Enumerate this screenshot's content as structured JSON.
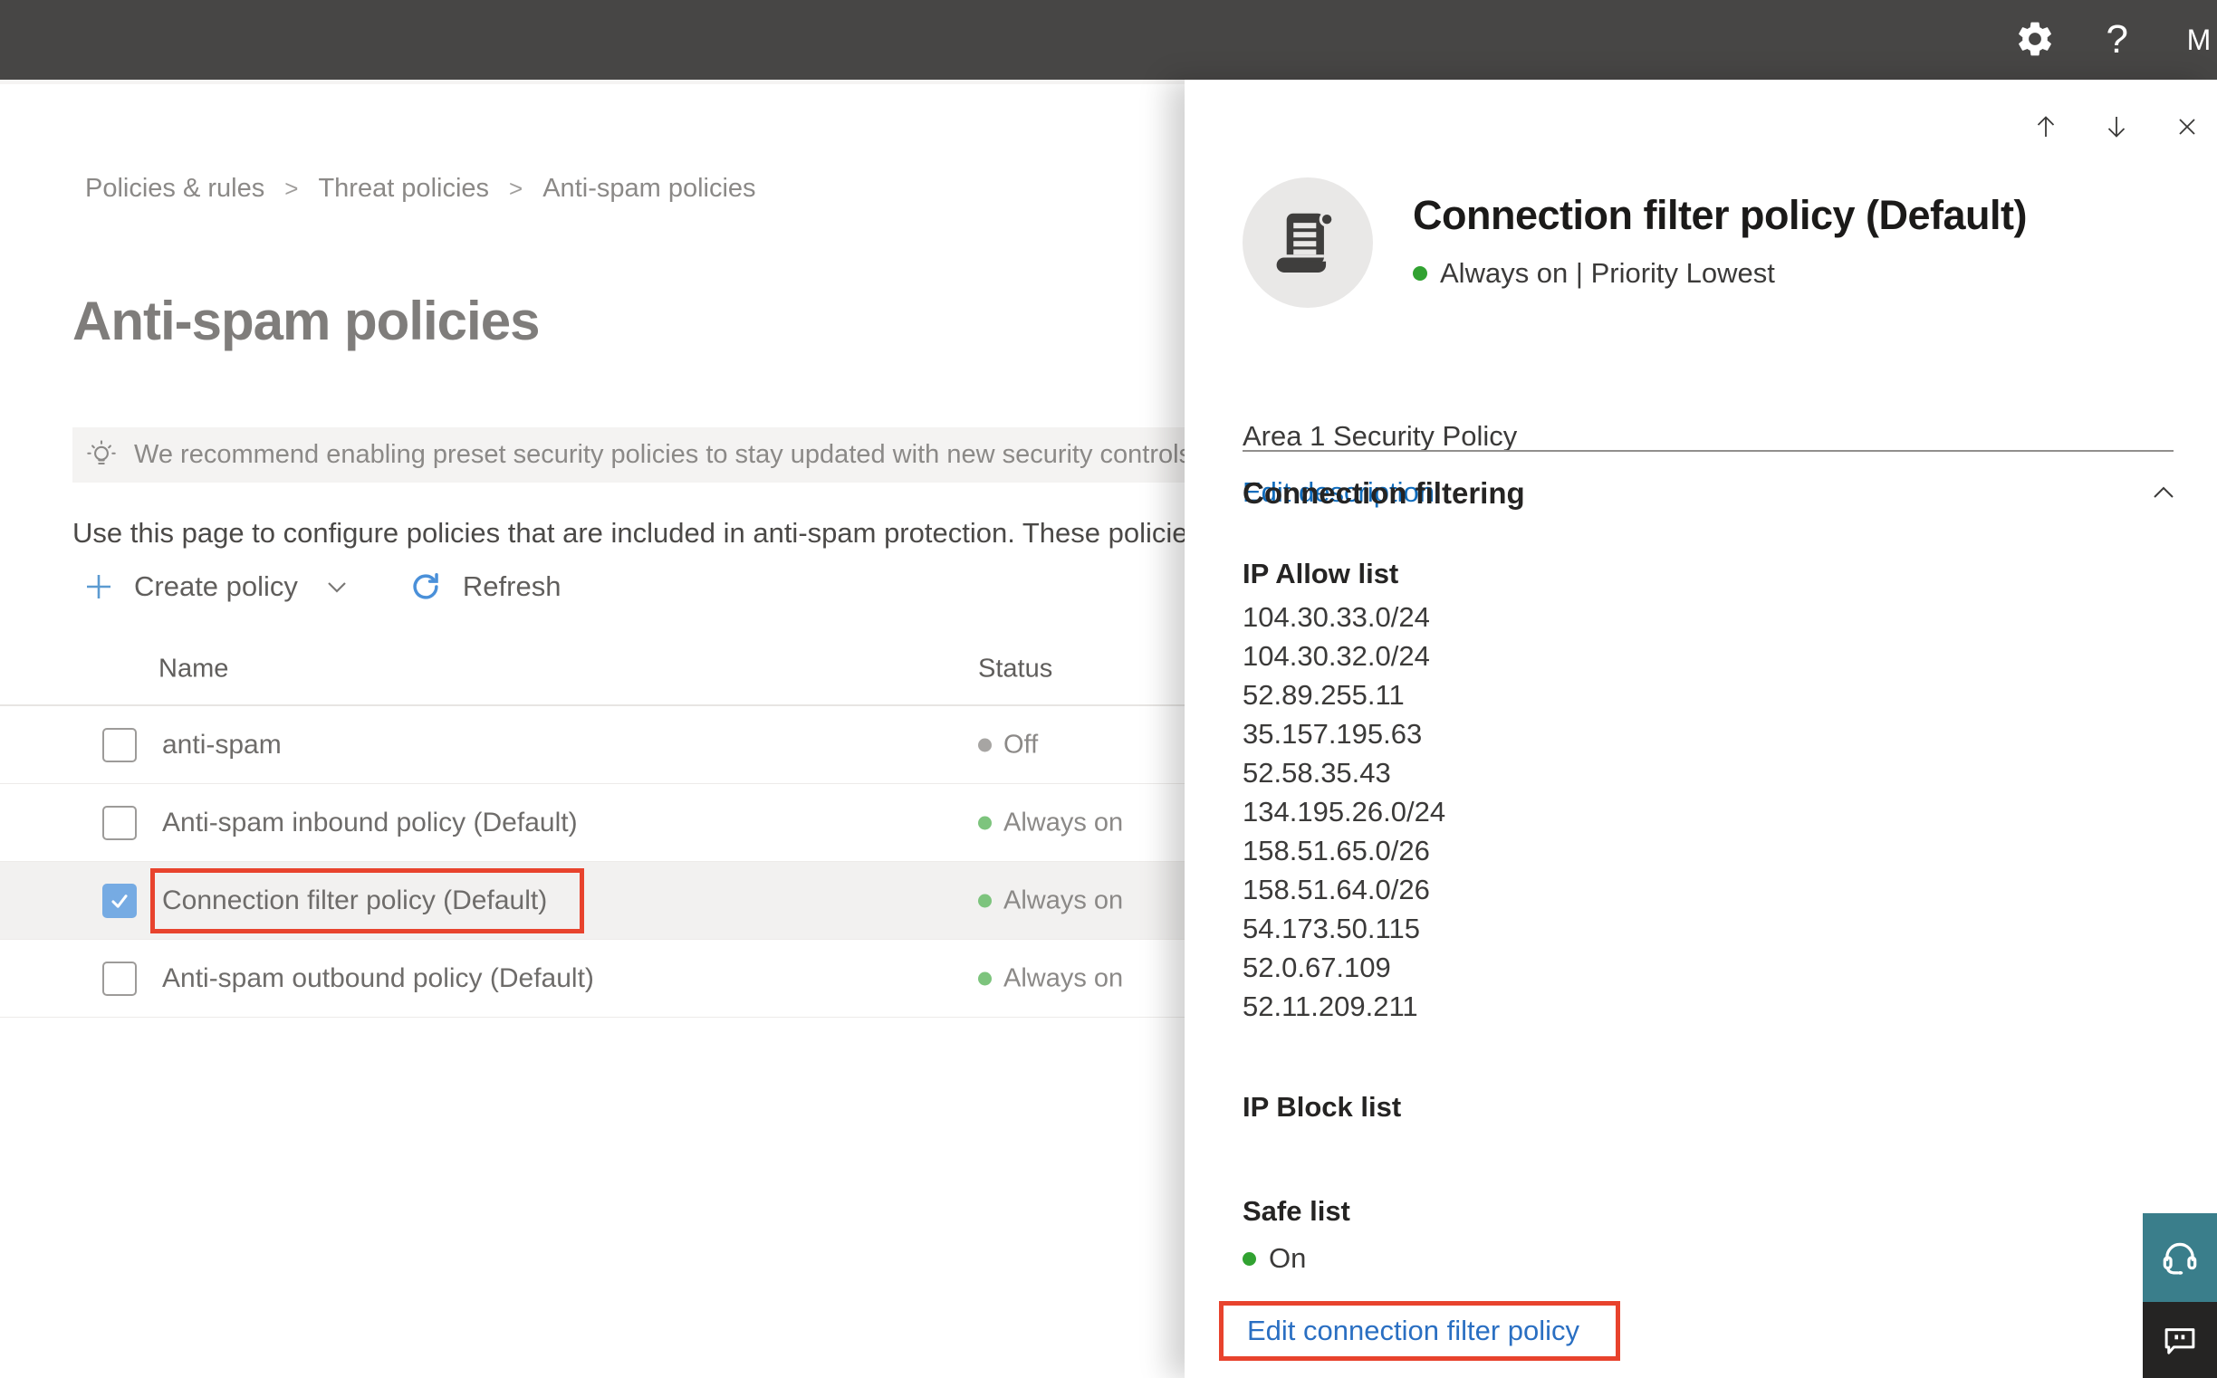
{
  "topbar": {
    "avatar_initial": "M",
    "help_glyph": "?"
  },
  "breadcrumb": {
    "items": [
      "Policies & rules",
      "Threat policies",
      "Anti-spam policies"
    ],
    "separator": ">"
  },
  "page": {
    "title": "Anti-spam policies",
    "banner": {
      "icon": "lightbulb-icon",
      "text": "We recommend enabling preset security policies to stay updated with new security controls and our recomme"
    },
    "description": "Use this page to configure policies that are included in anti-spam protection. These policies include",
    "toolbar": {
      "create_policy_label": "Create policy",
      "refresh_label": "Refresh"
    }
  },
  "table": {
    "columns": {
      "name": "Name",
      "status": "Status"
    },
    "rows": [
      {
        "name": "anti-spam",
        "status": "Off",
        "status_color": "#a7a5a3",
        "checked": false,
        "selected": false
      },
      {
        "name": "Anti-spam inbound policy (Default)",
        "status": "Always on",
        "status_color": "#7dc47d",
        "checked": false,
        "selected": false
      },
      {
        "name": "Connection filter policy (Default)",
        "status": "Always on",
        "status_color": "#7dc47d",
        "checked": true,
        "selected": true
      },
      {
        "name": "Anti-spam outbound policy (Default)",
        "status": "Always on",
        "status_color": "#7dc47d",
        "checked": false,
        "selected": false
      }
    ]
  },
  "panel": {
    "title": "Connection filter policy (Default)",
    "status_text": "Always on | Priority Lowest",
    "description": "Area 1 Security Policy",
    "edit_description_label": "Edit description",
    "section_title": "Connection filtering",
    "ip_allow": {
      "label": "IP Allow list",
      "items": [
        "104.30.33.0/24",
        "104.30.32.0/24",
        "52.89.255.11",
        "35.157.195.63",
        "52.58.35.43",
        "134.195.26.0/24",
        "158.51.65.0/26",
        "158.51.64.0/26",
        "54.173.50.115",
        "52.0.67.109",
        "52.11.209.211"
      ]
    },
    "ip_block": {
      "label": "IP Block list"
    },
    "safe_list": {
      "label": "Safe list",
      "status": "On"
    },
    "edit_policy_label": "Edit connection filter policy"
  },
  "icons": {
    "settings": "gear",
    "help": "?",
    "previous": "arrow-up",
    "next": "arrow-down",
    "close": "x",
    "chevron_down": "v",
    "chevron_up": "^",
    "plus": "+",
    "refresh": "circular-arrow",
    "lightbulb": "tip-bulb",
    "policy": "scroll",
    "support": "headset",
    "feedback": "chat-bubble",
    "check": "checkmark"
  },
  "colors": {
    "topbar_bg": "#474645",
    "accent_blue": "#0f6cbd",
    "highlight_red": "#e8432d",
    "status_green_panel": "#31a231",
    "status_green_table": "#7dc47d",
    "status_gray_off": "#a7a5a3",
    "selected_row_bg": "#f2f1f0",
    "checkbox_blue": "#76abe3",
    "support_teal": "#3a7e8b",
    "feedback_dark": "#252423"
  }
}
